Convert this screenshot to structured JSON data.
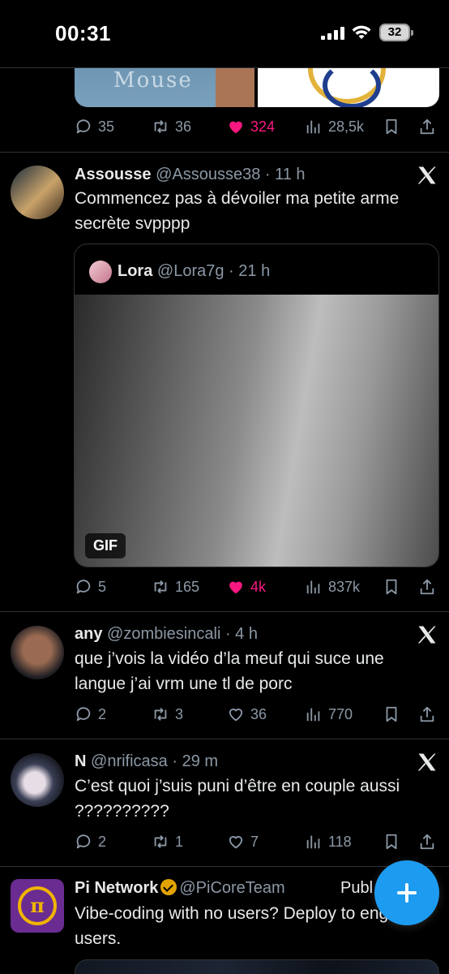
{
  "status_bar": {
    "time": "00:31",
    "battery": "32"
  },
  "prev_tweet": {
    "shirt_text": "Mouse",
    "actions": {
      "replies": "35",
      "reposts": "36",
      "likes": "324",
      "views": "28,5k"
    }
  },
  "tweets": [
    {
      "name": "Assousse",
      "handle": "@Assousse38",
      "time": "11 h",
      "text": "Commencez pas à dévoiler ma petite arme secrète svpppp",
      "quote": {
        "name": "Lora",
        "handle": "@Lora7g",
        "time": "21 h",
        "media_badge": "GIF"
      },
      "actions": {
        "replies": "5",
        "reposts": "165",
        "likes": "4k",
        "views": "837k"
      }
    },
    {
      "name": "any",
      "handle": "@zombiesincali",
      "time": "4 h",
      "text": "que j’vois la vidéo d’la meuf qui suce une langue j’ai vrm une tl de porc",
      "actions": {
        "replies": "2",
        "reposts": "3",
        "likes": "36",
        "views": "770"
      }
    },
    {
      "name": "N",
      "handle": "@nrificasa",
      "time": "29 m",
      "text": "C’est quoi j’suis puni d’être en couple aussi ??????????",
      "actions": {
        "replies": "2",
        "reposts": "1",
        "likes": "7",
        "views": "118"
      }
    }
  ],
  "ad": {
    "name": "Pi Network",
    "handle": "@PiCoreTeam",
    "label": "Publ",
    "text": "Vibe-coding with no users? Deploy to engaged users.",
    "avatar_glyph": "π"
  },
  "colors": {
    "background": "#000000",
    "accent": "#1d9bf0",
    "like": "#f91880",
    "muted": "#8b98a5",
    "divider": "#2f3336"
  }
}
